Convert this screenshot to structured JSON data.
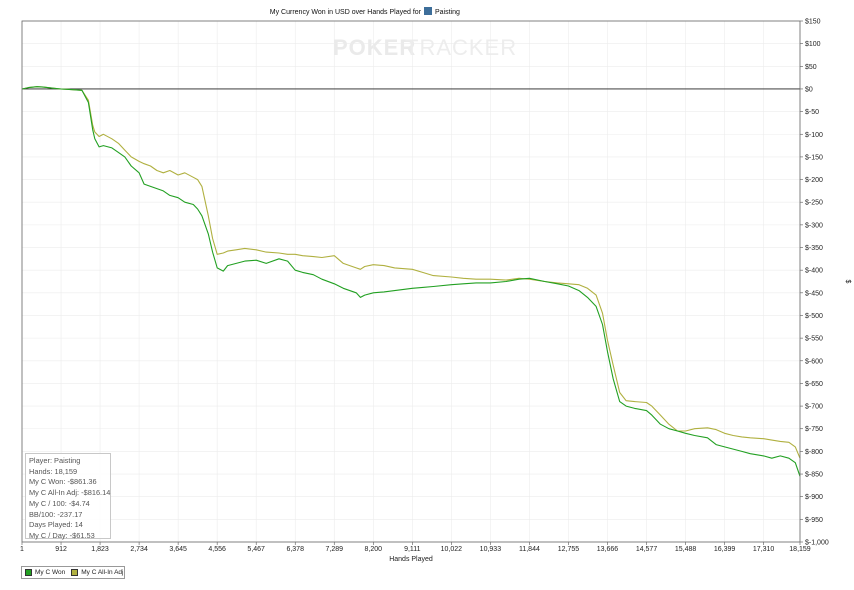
{
  "chart_data": {
    "type": "line",
    "title": "My Currency Won in USD over Hands Played for",
    "title_player": "Paisting",
    "watermark": {
      "part1": "POKER",
      "part2": "TRACKER"
    },
    "xlabel": "Hands Played",
    "ylabel": "$",
    "x_ticks": [
      1,
      912,
      1823,
      2734,
      3645,
      4556,
      5467,
      6378,
      7289,
      8200,
      9111,
      10022,
      10933,
      11844,
      12755,
      13666,
      14577,
      15488,
      16399,
      17310,
      18159
    ],
    "x_tick_labels": [
      "1",
      "912",
      "1,823",
      "2,734",
      "3,645",
      "4,556",
      "5,467",
      "6,378",
      "7,289",
      "8,200",
      "9,111",
      "10,022",
      "10,933",
      "11,844",
      "12,755",
      "13,666",
      "14,577",
      "15,488",
      "16,399",
      "17,310",
      "18,159"
    ],
    "y_ticks": [
      150,
      100,
      50,
      0,
      -50,
      -100,
      -150,
      -200,
      -250,
      -300,
      -350,
      -400,
      -450,
      -500,
      -550,
      -600,
      -650,
      -700,
      -750,
      -800,
      -850,
      -900,
      -950,
      -1000
    ],
    "y_tick_labels": [
      "$150",
      "$100",
      "$50",
      "$0",
      "$-50",
      "$-100",
      "$-150",
      "$-200",
      "$-250",
      "$-300",
      "$-350",
      "$-400",
      "$-450",
      "$-500",
      "$-550",
      "$-600",
      "$-650",
      "$-700",
      "$-750",
      "$-800",
      "$-850",
      "$-900",
      "$-950",
      "$-1,000"
    ],
    "xlim": [
      1,
      18159
    ],
    "ylim": [
      -1000,
      150
    ],
    "grid": true,
    "legend_position": "bottom-left",
    "series": [
      {
        "name": "My C Won",
        "color": "#22a022",
        "x": [
          1,
          150,
          350,
          500,
          700,
          912,
          1100,
          1400,
          1550,
          1650,
          1700,
          1800,
          1900,
          2100,
          2250,
          2400,
          2550,
          2734,
          2850,
          3000,
          3150,
          3300,
          3450,
          3645,
          3800,
          4000,
          4100,
          4200,
          4350,
          4450,
          4556,
          4700,
          4800,
          5000,
          5200,
          5467,
          5700,
          6000,
          6200,
          6378,
          6550,
          6800,
          7000,
          7289,
          7500,
          7800,
          7900,
          8000,
          8200,
          8450,
          8700,
          9111,
          9350,
          9600,
          10022,
          10300,
          10600,
          10933,
          11300,
          11600,
          11844,
          12200,
          12500,
          12755,
          13000,
          13200,
          13400,
          13550,
          13666,
          13800,
          13950,
          14100,
          14300,
          14577,
          14700,
          14900,
          15100,
          15300,
          15488,
          15700,
          16000,
          16200,
          16399,
          16600,
          16800,
          17000,
          17310,
          17500,
          17700,
          17900,
          18050,
          18159
        ],
        "y": [
          0,
          3,
          5,
          4,
          2,
          0,
          -1,
          -3,
          -30,
          -90,
          -110,
          -128,
          -125,
          -130,
          -140,
          -150,
          -170,
          -185,
          -210,
          -215,
          -220,
          -225,
          -235,
          -240,
          -250,
          -255,
          -265,
          -280,
          -320,
          -360,
          -395,
          -402,
          -390,
          -385,
          -380,
          -378,
          -385,
          -375,
          -380,
          -400,
          -405,
          -410,
          -420,
          -430,
          -440,
          -450,
          -460,
          -455,
          -450,
          -448,
          -445,
          -440,
          -438,
          -436,
          -432,
          -430,
          -428,
          -428,
          -425,
          -420,
          -418,
          -425,
          -430,
          -435,
          -445,
          -460,
          -480,
          -520,
          -580,
          -640,
          -690,
          -700,
          -705,
          -710,
          -720,
          -740,
          -750,
          -755,
          -760,
          -765,
          -770,
          -785,
          -790,
          -795,
          -800,
          -805,
          -810,
          -815,
          -810,
          -815,
          -825,
          -855
        ]
      },
      {
        "name": "My C All-In Adj",
        "color": "#b0b040",
        "x": [
          1,
          150,
          350,
          500,
          700,
          912,
          1100,
          1400,
          1550,
          1650,
          1700,
          1800,
          1900,
          2100,
          2250,
          2400,
          2550,
          2734,
          2850,
          3000,
          3150,
          3300,
          3450,
          3645,
          3800,
          4000,
          4100,
          4200,
          4350,
          4450,
          4556,
          4700,
          4800,
          5000,
          5200,
          5467,
          5700,
          6000,
          6200,
          6378,
          6550,
          6800,
          7000,
          7289,
          7500,
          7800,
          7900,
          8000,
          8200,
          8450,
          8700,
          9111,
          9350,
          9600,
          10022,
          10300,
          10600,
          10933,
          11300,
          11600,
          11844,
          12200,
          12500,
          12755,
          13000,
          13200,
          13400,
          13550,
          13666,
          13800,
          13950,
          14100,
          14300,
          14577,
          14700,
          14900,
          15100,
          15300,
          15488,
          15700,
          16000,
          16200,
          16399,
          16600,
          16800,
          17000,
          17310,
          17500,
          17700,
          17900,
          18050,
          18159
        ],
        "y": [
          0,
          3,
          5,
          4,
          2,
          0,
          -1,
          -3,
          -25,
          -80,
          -95,
          -105,
          -100,
          -110,
          -120,
          -135,
          -150,
          -160,
          -165,
          -170,
          -180,
          -185,
          -180,
          -190,
          -185,
          -195,
          -200,
          -215,
          -280,
          -330,
          -365,
          -362,
          -358,
          -355,
          -352,
          -355,
          -360,
          -362,
          -365,
          -365,
          -368,
          -370,
          -372,
          -368,
          -385,
          -395,
          -398,
          -392,
          -388,
          -390,
          -395,
          -398,
          -405,
          -412,
          -415,
          -418,
          -420,
          -420,
          -422,
          -418,
          -420,
          -425,
          -428,
          -430,
          -432,
          -440,
          -455,
          -495,
          -555,
          -610,
          -670,
          -688,
          -690,
          -692,
          -700,
          -720,
          -740,
          -755,
          -755,
          -750,
          -748,
          -752,
          -760,
          -765,
          -768,
          -770,
          -772,
          -775,
          -778,
          -780,
          -790,
          -815
        ]
      }
    ]
  },
  "stats": {
    "player": "Player: Paisting",
    "hands": "Hands: 18,159",
    "won": "My C Won: -$861.36",
    "allin": "My C All-In Adj: -$816.14",
    "per100": "My C / 100: -$4.74",
    "bb100": "BB/100: -237.17",
    "days": "Days Played: 14",
    "perday": "My C / Day: -$61.53"
  },
  "legend": {
    "won_label": "My C Won",
    "allin_label": "My C All-In Adj",
    "won_color": "#22a022",
    "allin_color": "#b0b040"
  }
}
